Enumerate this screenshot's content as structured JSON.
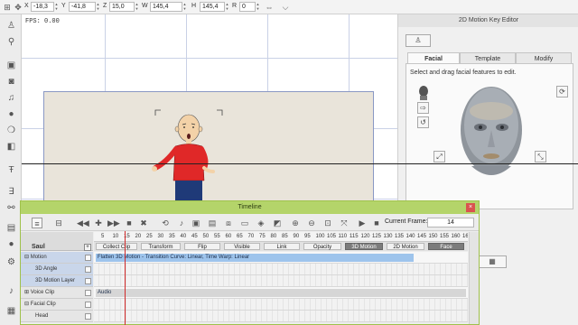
{
  "toolbar": {
    "x_label": "X",
    "x_value": "-18,3",
    "y_label": "Y",
    "y_value": "-41,8",
    "z_label": "Z",
    "z_value": "15,0",
    "w_label": "W",
    "w_value": "145,4",
    "h_label": "H",
    "h_value": "145,4",
    "r_label": "R",
    "r_value": "0",
    "icons": [
      "select-icon",
      "move-icon",
      "resize-icon",
      "flip-icon",
      "arrow-icon"
    ]
  },
  "left_toolbar": {
    "icons": [
      "actor-icon",
      "walk-icon",
      "stage-icon",
      "camera-icon",
      "image-icon",
      "music-icon",
      "record-icon",
      "bubble-icon",
      "props-icon",
      "text-icon",
      "3d-icon",
      "link-icon",
      "save-icon",
      "sound-icon",
      "record-dot-icon",
      "settings-icon"
    ]
  },
  "stage": {
    "fps_label": "FPS: 0.00"
  },
  "right_panel": {
    "title": "2D Motion Key Editor",
    "tabs": [
      {
        "label": "Facial",
        "active": true
      },
      {
        "label": "Template",
        "active": false
      },
      {
        "label": "Modify",
        "active": false
      }
    ],
    "instruction": "Select and drag facial features to edit."
  },
  "timeline": {
    "title": "Timeline",
    "close_glyph": "×",
    "current_frame_label": "Current Frame:",
    "current_frame_value": "14",
    "track_name": "Saul",
    "ruler_ticks": [
      "5",
      "10",
      "15",
      "20",
      "25",
      "30",
      "35",
      "40",
      "45",
      "50",
      "55",
      "60",
      "65",
      "70",
      "75",
      "80",
      "85",
      "90",
      "95",
      "100",
      "105",
      "110",
      "115",
      "120",
      "125",
      "130",
      "135",
      "140",
      "145",
      "150",
      "155",
      "160",
      "16"
    ],
    "categories": [
      {
        "label": "Collect Clip",
        "dark": false
      },
      {
        "label": "Transform",
        "dark": false
      },
      {
        "label": "Flip",
        "dark": false
      },
      {
        "label": "Visible",
        "dark": false
      },
      {
        "label": "Link",
        "dark": false
      },
      {
        "label": "Opacity",
        "dark": false
      },
      {
        "label": "3D Motion",
        "dark": true
      },
      {
        "label": "2D Motion",
        "dark": false
      },
      {
        "label": "Face",
        "dark": true
      }
    ],
    "tracks": [
      {
        "label": "Motion",
        "prefix": "⊟",
        "clip": "Flatten 3D Motion - Transition Curve: Linear, Time Warp: Linear",
        "clip_color": "#9ec4ec",
        "selected": true
      },
      {
        "label": "3D Angle",
        "prefix": "",
        "clip": "",
        "clip_color": "",
        "selected": true
      },
      {
        "label": "3D Motion Layer",
        "prefix": "",
        "clip": "",
        "clip_color": "",
        "selected": true
      },
      {
        "label": "Voice Clip",
        "prefix": "⊞",
        "clip": "Audio",
        "clip_color": "#d6d6d6",
        "selected": false
      },
      {
        "label": "Facial Clip",
        "prefix": "⊟",
        "clip": "",
        "clip_color": "",
        "selected": false
      },
      {
        "label": "Head",
        "prefix": "",
        "clip": "",
        "clip_color": "",
        "selected": false
      }
    ]
  },
  "colors": {
    "timeline_title_bar": "#b4d46a",
    "close_button": "#d9534f",
    "playhead": "#d02a2a",
    "selected_row": "#c9d6ea",
    "motion_clip": "#9ec4ec"
  }
}
